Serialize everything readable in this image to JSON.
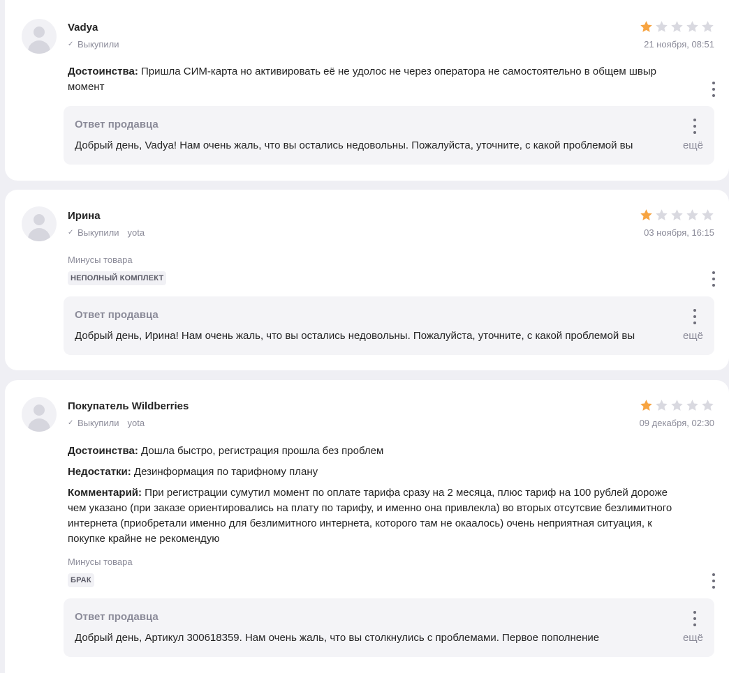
{
  "colors": {
    "background": "#efeff4",
    "card": "#ffffff",
    "star_filled": "#f7a441",
    "star_empty": "#d9d9e0",
    "muted_text": "#8b8b99"
  },
  "reviews": [
    {
      "author": "Vadya",
      "bought_label": "Выкупили",
      "tariff": "",
      "rating": 1,
      "date": "21 ноября, 08:51",
      "pros_label": "Достоинства:",
      "pros": " Пришла СИМ-карта но активировать её не удолос не через оператора не самостоятельно в общем швыр момент",
      "reply_title": "Ответ продавца",
      "reply_text": "Добрый день, Vadya! Нам очень жаль, что вы остались недовольны. Пожалуйста, уточните, с какой проблемой вы",
      "reply_more": "ещё"
    },
    {
      "author": "Ирина",
      "bought_label": "Выкупили",
      "tariff": "yota",
      "rating": 1,
      "date": "03 ноября, 16:15",
      "minus_label": "Минусы товара",
      "minus_chip": "НЕПОЛНЫЙ КОМПЛЕКТ",
      "reply_title": "Ответ продавца",
      "reply_text": "Добрый день, Ирина! Нам очень жаль, что вы остались недовольны. Пожалуйста, уточните, с какой проблемой вы",
      "reply_more": "ещё"
    },
    {
      "author": "Покупатель Wildberries",
      "bought_label": "Выкупили",
      "tariff": "yota",
      "rating": 1,
      "date": "09 декабря, 02:30",
      "pros_label": "Достоинства:",
      "pros": " Дошла быстро, регистрация прошла без проблем",
      "cons_label": "Недостатки:",
      "cons": " Дезинформация по тарифному плану",
      "comment_label": "Комментарий:",
      "comment": " При регистрации сумутил момент по оплате тарифа сразу на 2 месяца, плюс тариф на 100 рублей дороже чем указано (при заказе ориентировались на плату по тарифу, и именно она привлекла) во вторых отсутсвие безлимитного интернета (приобретали именно для безлимитного интернета, которого там не окаалось) очень неприятная ситуация, к покупке крайне не рекомендую",
      "minus_label": "Минусы товара",
      "minus_chip": "БРАК",
      "reply_title": "Ответ продавца",
      "reply_text": "Добрый день, Артикул 300618359. Нам очень жаль, что вы столкнулись с проблемами. Первое пополнение",
      "reply_more": "ещё"
    }
  ]
}
